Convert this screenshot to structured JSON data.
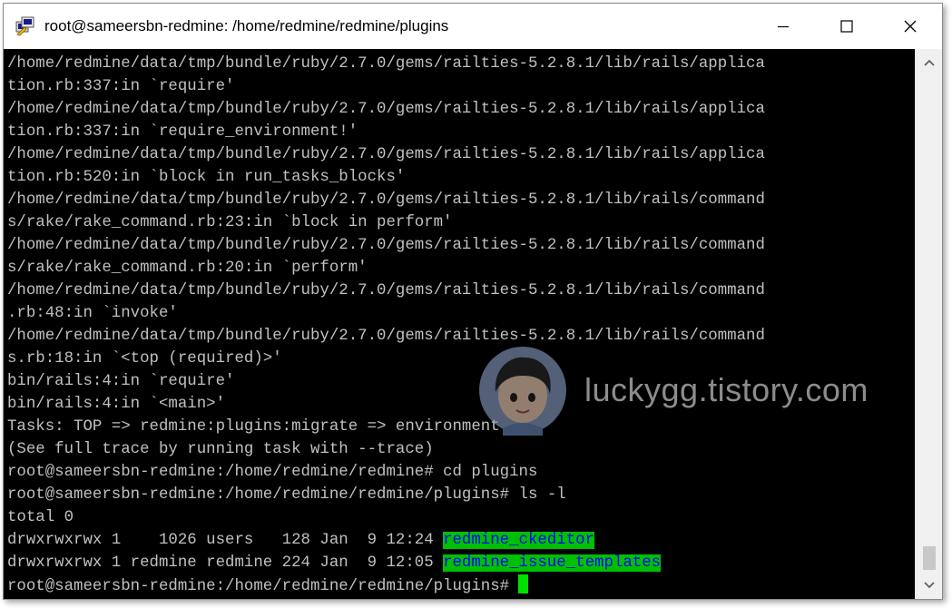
{
  "window": {
    "title": "root@sameersbn-redmine: /home/redmine/redmine/plugins"
  },
  "terminal": {
    "lines": [
      "/home/redmine/data/tmp/bundle/ruby/2.7.0/gems/railties-5.2.8.1/lib/rails/applica",
      "tion.rb:337:in `require'",
      "/home/redmine/data/tmp/bundle/ruby/2.7.0/gems/railties-5.2.8.1/lib/rails/applica",
      "tion.rb:337:in `require_environment!'",
      "/home/redmine/data/tmp/bundle/ruby/2.7.0/gems/railties-5.2.8.1/lib/rails/applica",
      "tion.rb:520:in `block in run_tasks_blocks'",
      "/home/redmine/data/tmp/bundle/ruby/2.7.0/gems/railties-5.2.8.1/lib/rails/command",
      "s/rake/rake_command.rb:23:in `block in perform'",
      "/home/redmine/data/tmp/bundle/ruby/2.7.0/gems/railties-5.2.8.1/lib/rails/command",
      "s/rake/rake_command.rb:20:in `perform'",
      "/home/redmine/data/tmp/bundle/ruby/2.7.0/gems/railties-5.2.8.1/lib/rails/command",
      ".rb:48:in `invoke'",
      "/home/redmine/data/tmp/bundle/ruby/2.7.0/gems/railties-5.2.8.1/lib/rails/command",
      "s.rb:18:in `<top (required)>'",
      "bin/rails:4:in `require'",
      "bin/rails:4:in `<main>'",
      "Tasks: TOP => redmine:plugins:migrate => environment",
      "(See full trace by running task with --trace)",
      "root@sameersbn-redmine:/home/redmine/redmine# cd plugins",
      "root@sameersbn-redmine:/home/redmine/redmine/plugins# ls -l",
      "total 0"
    ],
    "listing": [
      {
        "prefix": "drwxrwxrwx 1    1026 users   128 Jan  9 12:24 ",
        "name": "redmine_ckeditor"
      },
      {
        "prefix": "drwxrwxrwx 1 redmine redmine 224 Jan  9 12:05 ",
        "name": "redmine_issue_templates"
      }
    ],
    "prompt": "root@sameersbn-redmine:/home/redmine/redmine/plugins#",
    "highlight_bg": "#00c000",
    "highlight_fg": "#0000ff",
    "cursor_color": "#00e000"
  },
  "watermark": {
    "text": "luckygg.tistory.com"
  },
  "icons": {
    "app": "putty-icon",
    "minimize": "minimize-icon",
    "maximize": "maximize-icon",
    "close": "close-icon",
    "scroll_up": "chevron-up-icon",
    "scroll_down": "chevron-down-icon"
  }
}
